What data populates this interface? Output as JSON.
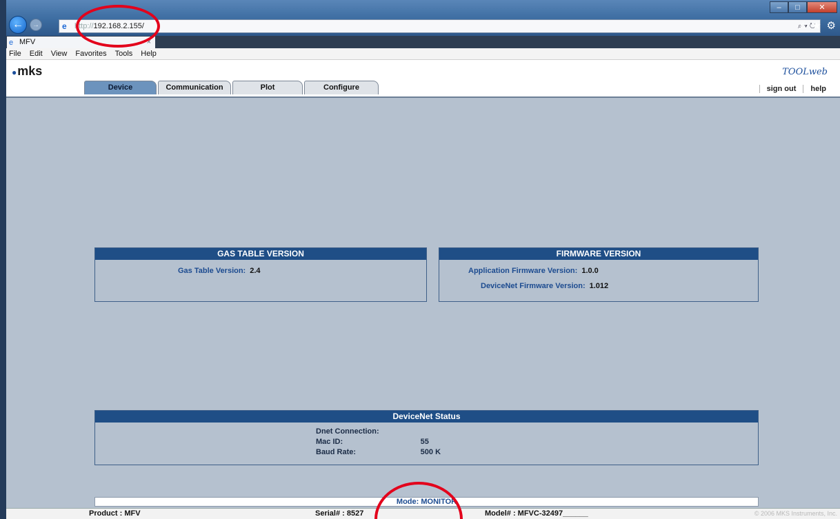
{
  "browser": {
    "url_prefix": "http://",
    "url_host": "192.168.2.155/",
    "tab_title": "MFV",
    "tab_close": "×",
    "menu": [
      "File",
      "Edit",
      "View",
      "Favorites",
      "Tools",
      "Help"
    ],
    "window_controls": {
      "minimize": "–",
      "maximize": "□",
      "close": "✕"
    }
  },
  "app": {
    "logo": "mks",
    "brand": "TOOLweb",
    "tabs": [
      "Device",
      "Communication",
      "Plot",
      "Configure"
    ],
    "active_tab": "Device",
    "links": {
      "sign_out": "sign out",
      "help": "help"
    }
  },
  "gas_table": {
    "title": "GAS TABLE VERSION",
    "label": "Gas Table Version:",
    "value": "2.4"
  },
  "firmware": {
    "title": "FIRMWARE VERSION",
    "app_label": "Application Firmware Version:",
    "app_value": "1.0.0",
    "dnet_label": "DeviceNet Firmware Version:",
    "dnet_value": "1.012"
  },
  "devicenet_status": {
    "title": "DeviceNet Status",
    "rows": [
      {
        "label": "Dnet Connection:",
        "value": ""
      },
      {
        "label": "Mac ID:",
        "value": "55"
      },
      {
        "label": "Baud Rate:",
        "value": "500 K"
      }
    ]
  },
  "mode": "Mode: MONITOR",
  "status_bar": {
    "product": "Product : MFV",
    "serial": "Serial# : 8527",
    "model": "Model# : MFVC-32497______",
    "copyright": "© 2006 MKS Instruments, Inc."
  },
  "annotation_color": "#e3001b"
}
